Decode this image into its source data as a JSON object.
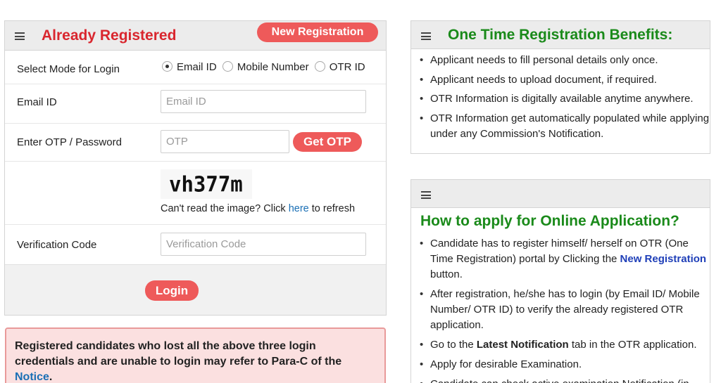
{
  "login_panel": {
    "title": "Already Registered",
    "new_registration_button": "New Registration",
    "mode_label": "Select Mode for Login",
    "mode_options": [
      "Email ID",
      "Mobile Number",
      "OTR ID"
    ],
    "mode_selected": "Email ID",
    "email_label": "Email ID",
    "email_placeholder": "Email ID",
    "otp_label": "Enter OTP / Password",
    "otp_placeholder": "OTP",
    "get_otp_button": "Get OTP",
    "captcha_text": "vh377m",
    "captcha_help_prefix": "Can't read the image? Click ",
    "captcha_help_link": "here",
    "captcha_help_suffix": " to refresh",
    "verification_label": "Verification Code",
    "verification_placeholder": "Verification Code",
    "login_button": "Login"
  },
  "notice_alert": {
    "text": "Registered candidates who lost all the above three login credentials and are unable to login may refer to Para-C of the ",
    "link": "Notice",
    "suffix": "."
  },
  "benefits_panel": {
    "title": "One Time Registration Benefits:",
    "items": [
      "Applicant needs to fill personal details only once.",
      "Applicant needs to upload document, if required.",
      "OTR Information is digitally available anytime anywhere.",
      "OTR Information get automatically populated while applying under any Commission's Notification."
    ]
  },
  "apply_panel": {
    "title": "How to apply for Online Application?",
    "item1_prefix": "Candidate has to register himself/ herself on OTR (One Time Registration) portal by Clicking the ",
    "item1_link": "New Registration",
    "item1_suffix": " button.",
    "item2": "After registration, he/she has to login (by Email ID/ Mobile Number/ OTR ID) to verify the already registered OTR application.",
    "item3_prefix": "Go to the ",
    "item3_bold": "Latest Notification",
    "item3_suffix": " tab in the OTR application.",
    "item4": "Apply for desirable Examination.",
    "item5": "Candidate can check active examination Notification (in"
  },
  "colors": {
    "title_red": "#d9262e",
    "title_green": "#1a8a1a",
    "button_red": "#ee5a5a",
    "link_blue": "#1a6fb5",
    "alert_bg": "#fbe0e0",
    "alert_border": "#e99a9a"
  },
  "icons": [
    "menu-icon"
  ]
}
